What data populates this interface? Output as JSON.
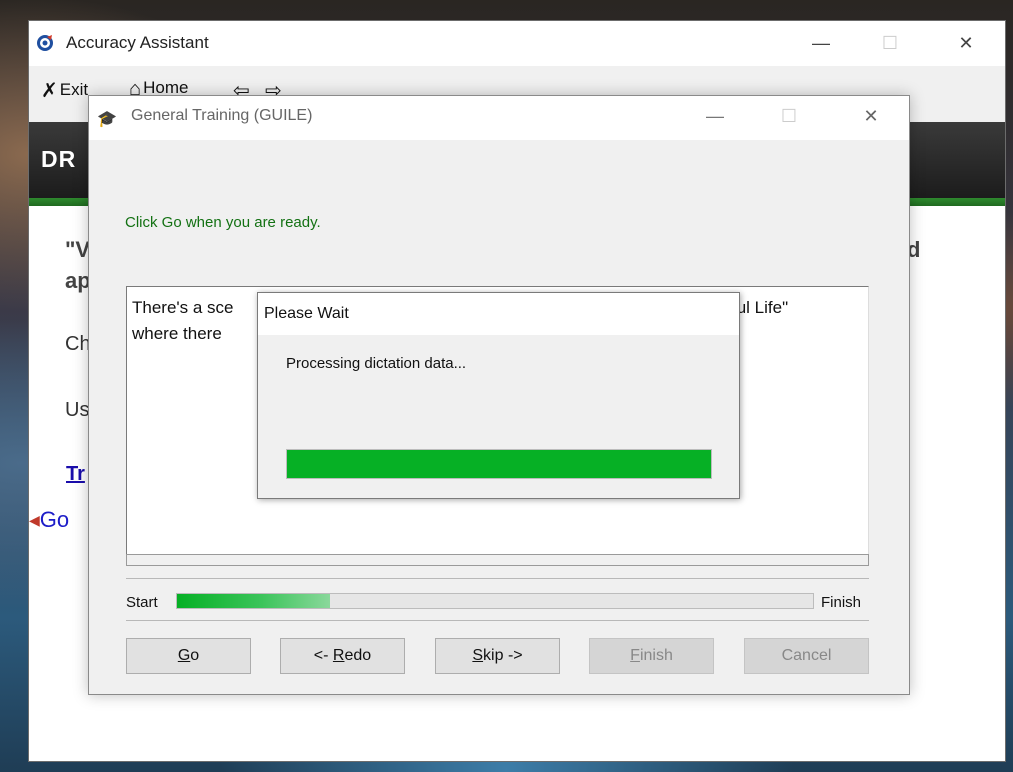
{
  "main_window": {
    "title": "Accuracy Assistant",
    "controls": {
      "minimize": "—",
      "maximize": "☐",
      "close": "✕"
    },
    "toolbar": {
      "exit_label": "Exit",
      "home_label": "Home",
      "back_icon": "⇦",
      "forward_icon": "⇨"
    },
    "banner_text": "DR",
    "background": {
      "quote_line1": "\"V",
      "quote_line2": "ap",
      "quote_right": "d",
      "line_ch": "Ch",
      "line_us": "Us",
      "link_tr": "Tr",
      "go_label": "Go"
    }
  },
  "training_dialog": {
    "title": "General Training (GUILE)",
    "instruction": "Click Go when you are ready.",
    "text_line1_left": "There's a sce",
    "text_line1_right": "ful Life\"",
    "text_line2_left": "where there",
    "start_label": "Start",
    "finish_label": "Finish",
    "progress_fraction": 0.24,
    "buttons": {
      "go": {
        "mnemonic": "G",
        "rest": "o"
      },
      "redo": {
        "prefix": "<- ",
        "mnemonic": "R",
        "rest": "edo"
      },
      "skip": {
        "mnemonic": "S",
        "rest": "kip ->"
      },
      "finish": {
        "mnemonic": "F",
        "rest": "inish"
      },
      "cancel": "Cancel"
    }
  },
  "wait_dialog": {
    "title": "Please Wait",
    "message": "Processing dictation data...",
    "progress_fraction": 1.0
  },
  "colors": {
    "progress_green": "#06b025",
    "instruction_green": "#137113",
    "link_blue": "#1a0dab"
  }
}
